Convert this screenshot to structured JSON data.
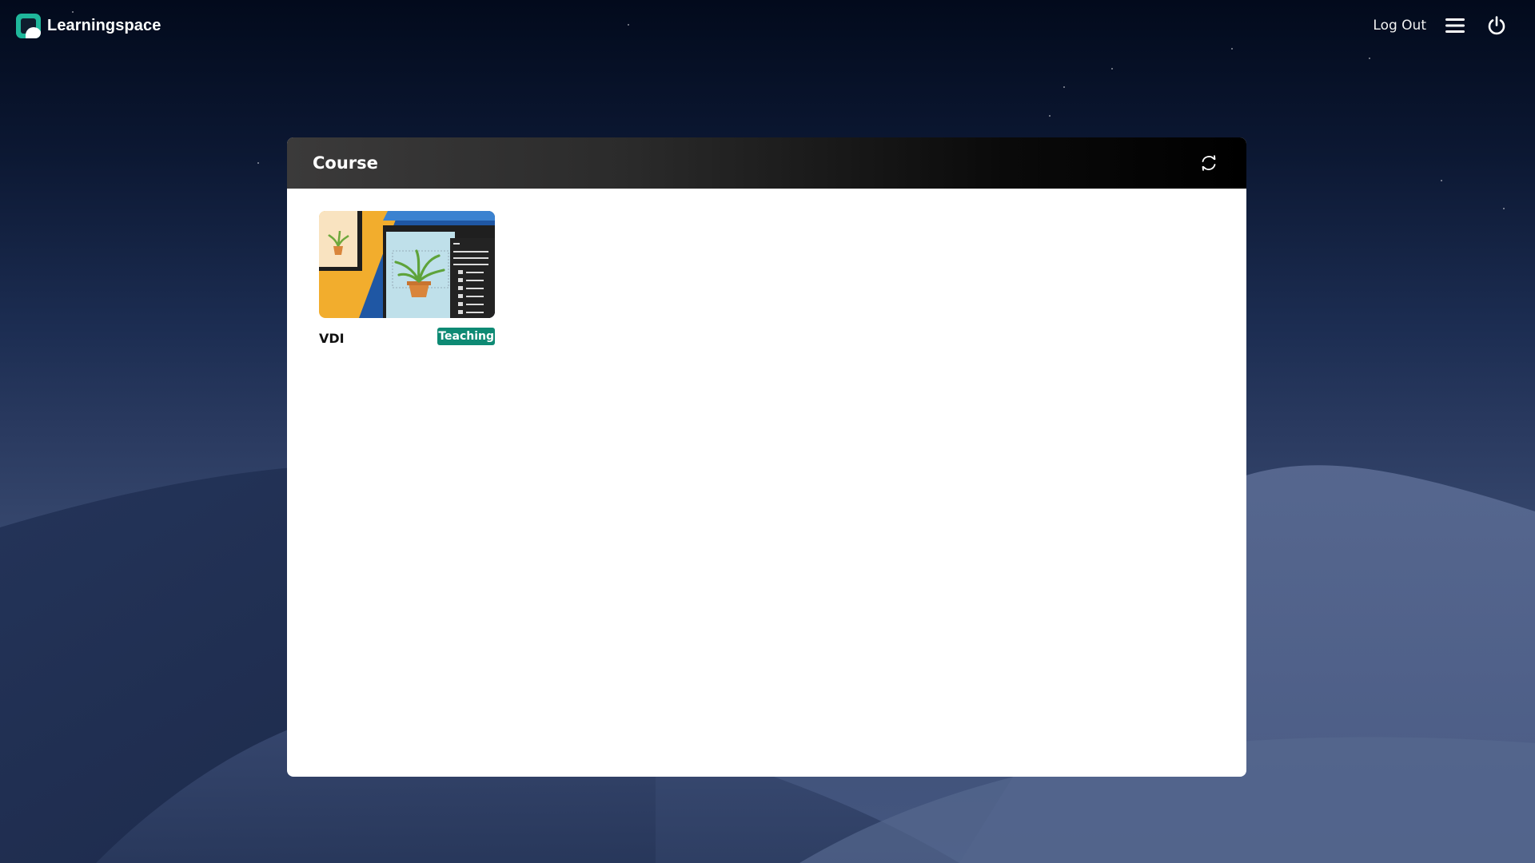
{
  "app": {
    "brand": "Learningspace",
    "logout_label": "Log Out"
  },
  "icons": {
    "menu": "hamburger-menu-icon",
    "power": "power-icon",
    "refresh": "refresh-icon"
  },
  "panel": {
    "title": "Course",
    "courses": [
      {
        "name": "VDI",
        "badge": "Teaching",
        "badge_color": "#0e8a74"
      }
    ]
  },
  "colors": {
    "accent": "#1fb79b",
    "badge": "#0e8a74"
  }
}
